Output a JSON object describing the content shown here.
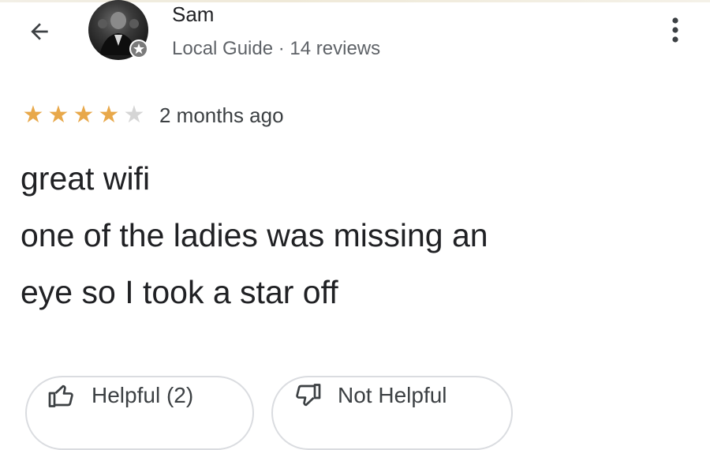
{
  "header": {
    "back_icon": "arrow-left-icon",
    "more_icon": "more-vertical-icon"
  },
  "author": {
    "name": "Sam",
    "meta": "Local Guide · 14 reviews",
    "avatar_badge_icon": "local-guide-badge-icon"
  },
  "review": {
    "rating": 4,
    "max_rating": 5,
    "time": "2 months ago",
    "lines": [
      "great wifi",
      "one of the ladies was missing an",
      "eye so I took a star off"
    ]
  },
  "actions": {
    "helpful_label": "Helpful (2)",
    "helpful_icon": "thumbs-up-icon",
    "not_helpful_label": "Not Helpful",
    "not_helpful_icon": "thumbs-down-icon"
  },
  "colors": {
    "star_filled": "#e8a84a",
    "star_empty": "#d5d5d5",
    "text_primary": "#202124",
    "text_secondary": "#5f6368",
    "button_border": "#dadce0"
  }
}
